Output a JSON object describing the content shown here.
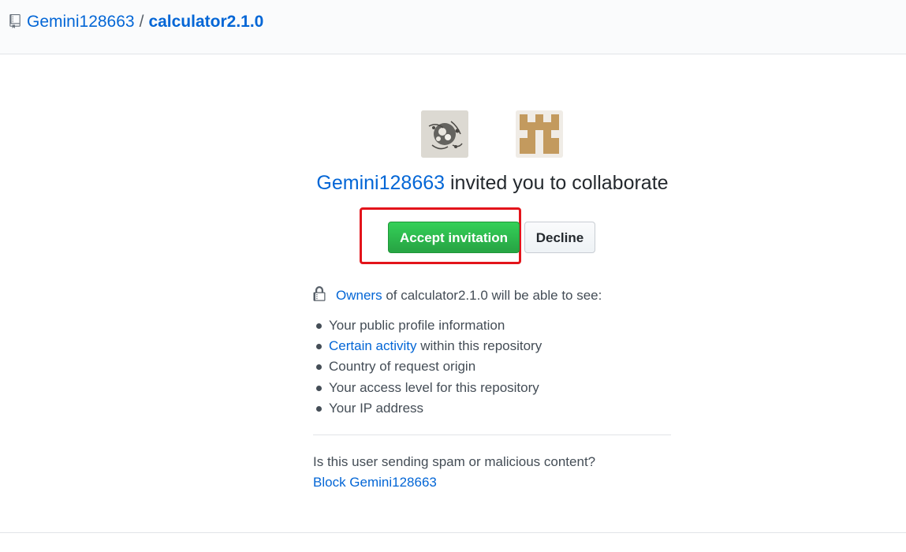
{
  "breadcrumb": {
    "owner": "Gemini128663",
    "separator": "/",
    "repo": "calculator2.1.0"
  },
  "invite": {
    "inviter": "Gemini128663",
    "message": "invited you to collaborate",
    "accept_label": "Accept invitation",
    "decline_label": "Decline"
  },
  "permissions": {
    "owners_link": "Owners",
    "owners_text": "of calculator2.1.0 will be able to see:",
    "items": [
      {
        "text": "Your public profile information"
      },
      {
        "link": "Certain activity",
        "text": "within this repository"
      },
      {
        "text": "Country of request origin"
      },
      {
        "text": "Your access level for this repository"
      },
      {
        "text": "Your IP address"
      }
    ]
  },
  "spam": {
    "question": "Is this user sending spam or malicious content?",
    "block_link": "Block Gemini128663"
  },
  "colors": {
    "link": "#0366d6",
    "accept_green": "#28a745",
    "highlight_red": "#e3141b"
  },
  "icons": {
    "repo": "repo-icon",
    "lock": "lock-icon"
  }
}
